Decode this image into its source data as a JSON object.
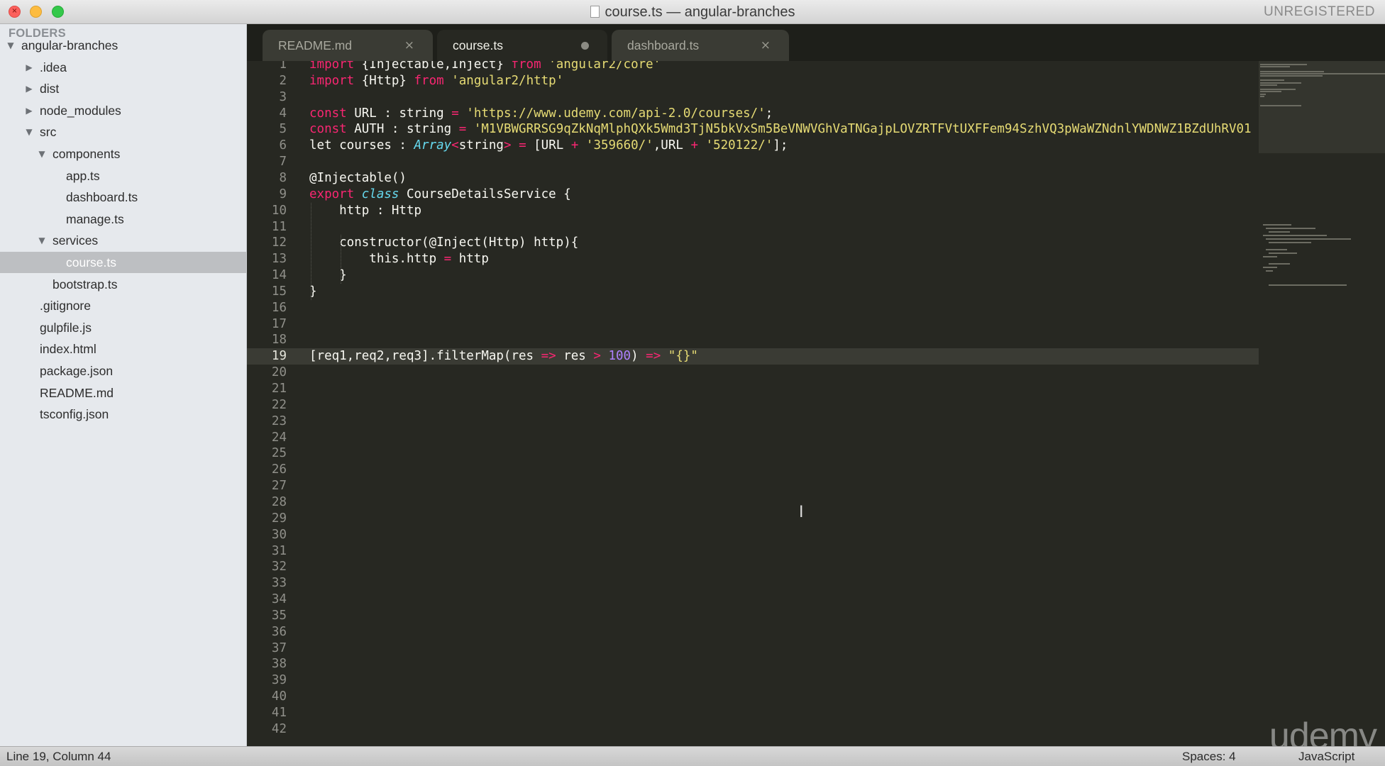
{
  "window": {
    "title": "course.ts — angular-branches",
    "registration": "UNREGISTERED",
    "close_glyph": "×"
  },
  "sidebar": {
    "heading": "FOLDERS",
    "items": [
      {
        "label": "angular-branches",
        "type": "folder",
        "expanded": true
      },
      {
        "label": ".idea",
        "type": "folder",
        "expanded": false
      },
      {
        "label": "dist",
        "type": "folder",
        "expanded": false
      },
      {
        "label": "node_modules",
        "type": "folder",
        "expanded": false
      },
      {
        "label": "src",
        "type": "folder",
        "expanded": true
      },
      {
        "label": "components",
        "type": "folder",
        "expanded": true
      },
      {
        "label": "app.ts",
        "type": "file"
      },
      {
        "label": "dashboard.ts",
        "type": "file"
      },
      {
        "label": "manage.ts",
        "type": "file"
      },
      {
        "label": "services",
        "type": "folder",
        "expanded": true
      },
      {
        "label": "course.ts",
        "type": "file",
        "selected": true
      },
      {
        "label": "bootstrap.ts",
        "type": "file"
      },
      {
        "label": ".gitignore",
        "type": "file"
      },
      {
        "label": "gulpfile.js",
        "type": "file"
      },
      {
        "label": "index.html",
        "type": "file"
      },
      {
        "label": "package.json",
        "type": "file"
      },
      {
        "label": "README.md",
        "type": "file"
      },
      {
        "label": "tsconfig.json",
        "type": "file"
      }
    ],
    "expanded_glyph": "▼",
    "collapsed_glyph": "▶"
  },
  "tabs": [
    {
      "label": "README.md",
      "active": false,
      "dirty": false,
      "close_glyph": "×"
    },
    {
      "label": "course.ts",
      "active": true,
      "dirty": true
    },
    {
      "label": "dashboard.ts",
      "active": false,
      "dirty": false,
      "close_glyph": "×"
    }
  ],
  "editor": {
    "current_line": 19,
    "line_count": 42,
    "code_lines": [
      [
        {
          "t": "import",
          "c": "kw"
        },
        {
          "t": " {Injectable,Inject} "
        },
        {
          "t": "from",
          "c": "kw"
        },
        {
          "t": " "
        },
        {
          "t": "'angular2/core'",
          "c": "st"
        }
      ],
      [
        {
          "t": "import",
          "c": "kw"
        },
        {
          "t": " {Http} "
        },
        {
          "t": "from",
          "c": "kw"
        },
        {
          "t": " "
        },
        {
          "t": "'angular2/http'",
          "c": "st"
        }
      ],
      [],
      [
        {
          "t": "const",
          "c": "kw"
        },
        {
          "t": " URL : string "
        },
        {
          "t": "=",
          "c": "kw"
        },
        {
          "t": " "
        },
        {
          "t": "'https://www.udemy.com/api-2.0/courses/'",
          "c": "st"
        },
        {
          "t": ";"
        }
      ],
      [
        {
          "t": "const",
          "c": "kw"
        },
        {
          "t": " AUTH : string "
        },
        {
          "t": "=",
          "c": "kw"
        },
        {
          "t": " "
        },
        {
          "t": "'M1VBWGRRSG9qZkNqMlphQXk5Wmd3TjN5bkVxSm5BeVNWVGhVaTNGajpLOVZRTFVtUXFFem94SzhVQ3pWaWZNdnlYWDNWZ1BZdUhRV01",
          "c": "st"
        }
      ],
      [
        {
          "t": "let courses : "
        },
        {
          "t": "Array",
          "c": "ty"
        },
        {
          "t": "<",
          "c": "kw"
        },
        {
          "t": "string"
        },
        {
          "t": ">",
          "c": "kw"
        },
        {
          "t": " "
        },
        {
          "t": "=",
          "c": "kw"
        },
        {
          "t": " [URL "
        },
        {
          "t": "+",
          "c": "kw"
        },
        {
          "t": " "
        },
        {
          "t": "'359660/'",
          "c": "st"
        },
        {
          "t": ",URL "
        },
        {
          "t": "+",
          "c": "kw"
        },
        {
          "t": " "
        },
        {
          "t": "'520122/'",
          "c": "st"
        },
        {
          "t": "];"
        }
      ],
      [],
      [
        {
          "t": "@Injectable()"
        }
      ],
      [
        {
          "t": "export",
          "c": "kw"
        },
        {
          "t": " "
        },
        {
          "t": "class",
          "c": "ty"
        },
        {
          "t": " CourseDetailsService {"
        }
      ],
      [
        {
          "t": "    http : Http"
        }
      ],
      [],
      [
        {
          "t": "    constructor(@Inject(Http) http){"
        }
      ],
      [
        {
          "t": "        this.http "
        },
        {
          "t": "=",
          "c": "kw"
        },
        {
          "t": " http"
        }
      ],
      [
        {
          "t": "    }"
        }
      ],
      [
        {
          "t": "}"
        }
      ],
      [],
      [],
      [],
      [
        {
          "t": "[req1,req2,req3].filterMap(res "
        },
        {
          "t": "=>",
          "c": "kw"
        },
        {
          "t": " res "
        },
        {
          "t": ">",
          "c": "kw"
        },
        {
          "t": " "
        },
        {
          "t": "100",
          "c": "nu"
        },
        {
          "t": ") "
        },
        {
          "t": "=>",
          "c": "kw"
        },
        {
          "t": " "
        },
        {
          "t": "\"{}\"",
          "c": "st"
        }
      ]
    ]
  },
  "cursor_glyph": "I",
  "watermark": "udemy",
  "status": {
    "position": "Line 19, Column 44",
    "indent": "Spaces: 4",
    "syntax": "JavaScript"
  }
}
